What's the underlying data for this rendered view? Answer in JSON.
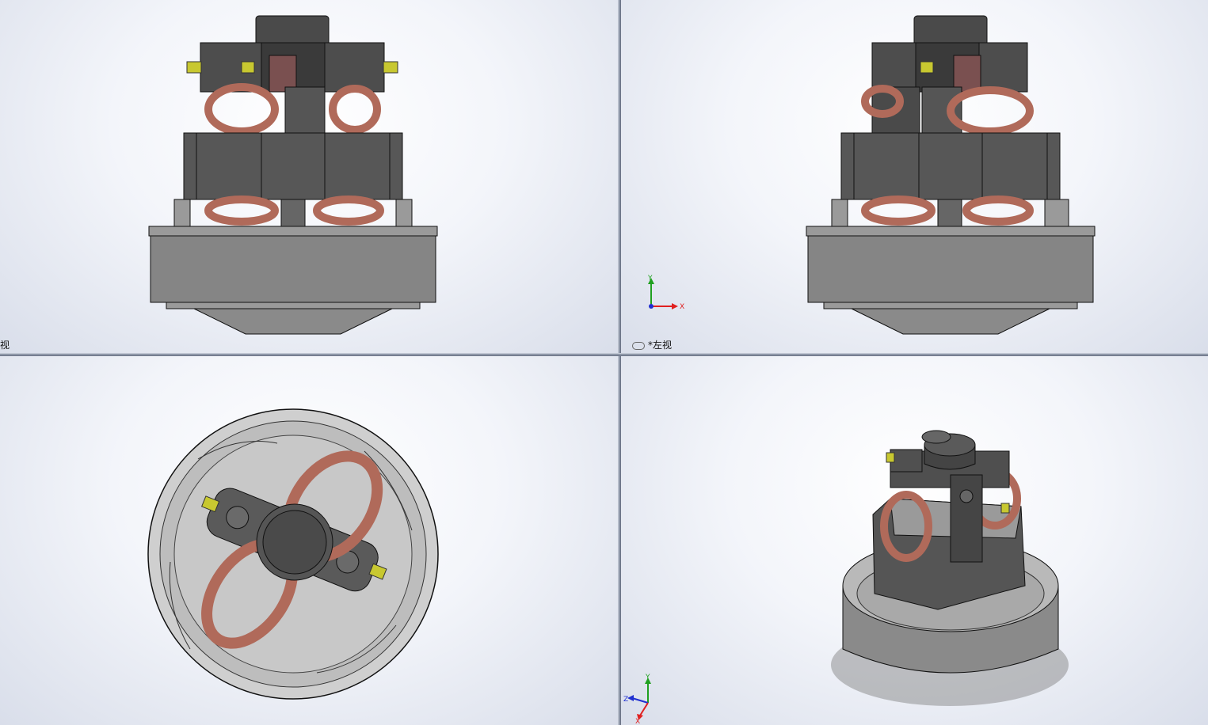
{
  "viewports": {
    "top_left": {
      "label": "视"
    },
    "top_right": {
      "label": "*左视"
    },
    "bottom_left": {
      "label": ""
    },
    "bottom_right": {
      "label": ""
    }
  },
  "triads": {
    "top_right": {
      "y": "Y",
      "x": "X"
    },
    "bottom_right": {
      "y": "Y",
      "z": "Z",
      "x": "X"
    }
  },
  "colors": {
    "body_gray": "#5a5a5a",
    "housing_gray": "#8a8a8a",
    "coil_copper": "#b06a5a",
    "terminal_yellow": "#c8c830",
    "axis_x": "#e02020",
    "axis_y": "#20a020",
    "axis_z": "#2030d0"
  }
}
